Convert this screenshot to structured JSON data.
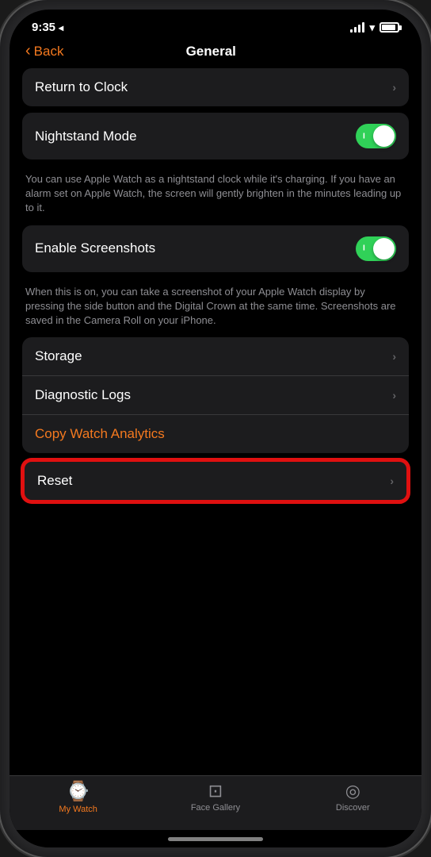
{
  "statusBar": {
    "time": "9:35",
    "locationIcon": "◂",
    "batteryPercent": 90
  },
  "navBar": {
    "backLabel": "Back",
    "title": "General"
  },
  "items": {
    "returnToClock": "Return to Clock",
    "nightstandMode": "Nightstand Mode",
    "nightstandDesc": "You can use Apple Watch as a nightstand clock while it's charging. If you have an alarm set on Apple Watch, the screen will gently brighten in the minutes leading up to it.",
    "enableScreenshots": "Enable Screenshots",
    "screenshotsDesc": "When this is on, you can take a screenshot of your Apple Watch display by pressing the side button and the Digital Crown at the same time. Screenshots are saved in the Camera Roll on your iPhone.",
    "storage": "Storage",
    "diagnosticLogs": "Diagnostic Logs",
    "copyWatchAnalytics": "Copy Watch Analytics",
    "reset": "Reset"
  },
  "tabBar": {
    "myWatchLabel": "My Watch",
    "faceGalleryLabel": "Face Gallery",
    "discoverLabel": "Discover",
    "myWatchIcon": "⌚",
    "faceGalleryIcon": "🕐",
    "discoverIcon": "🧭"
  }
}
